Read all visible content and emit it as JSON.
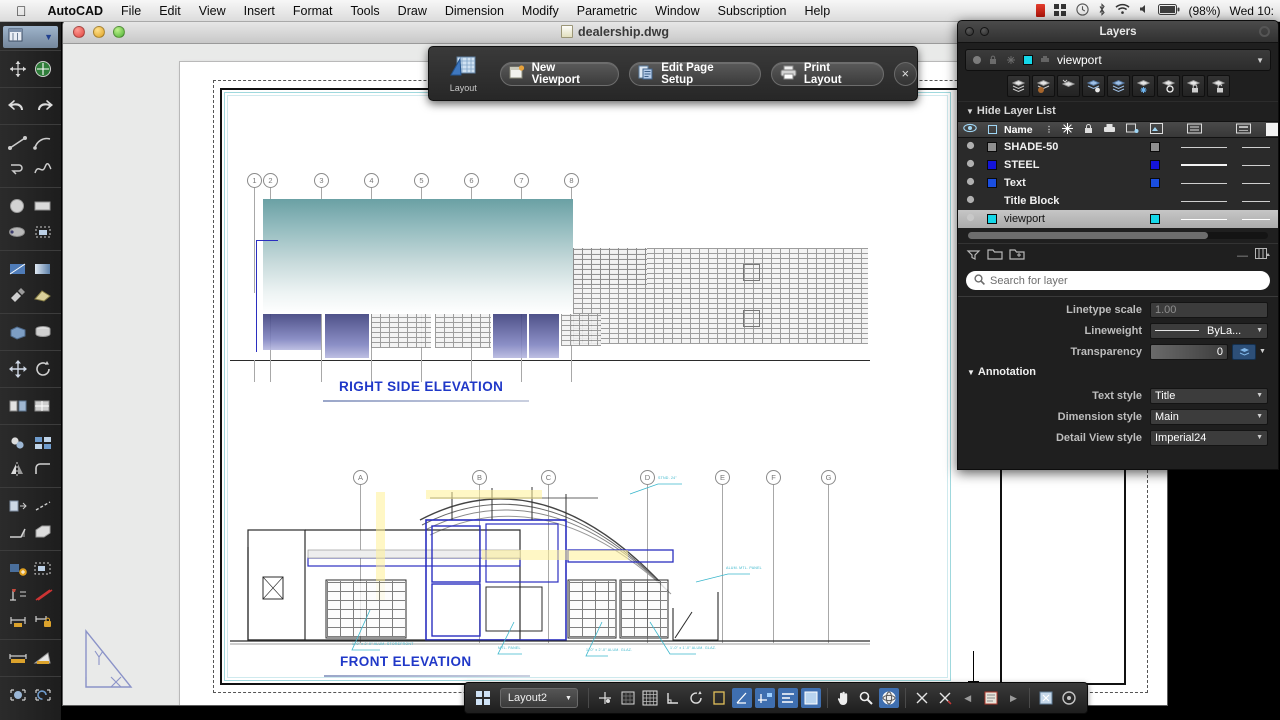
{
  "menubar": {
    "apple_icon": "apple-logo",
    "items": [
      "AutoCAD",
      "File",
      "Edit",
      "View",
      "Insert",
      "Format",
      "Tools",
      "Draw",
      "Dimension",
      "Modify",
      "Parametric",
      "Window",
      "Subscription",
      "Help"
    ],
    "status_icons": [
      "recording-icon",
      "grid-icon",
      "time-machine-icon",
      "bluetooth-icon",
      "wifi-icon",
      "volume-icon",
      "battery-icon"
    ],
    "battery": "(98%)",
    "clock": "Wed 10:"
  },
  "window": {
    "title": "dealership.dwg",
    "doc_icon": "dwg-file-icon",
    "traffic": [
      "close-button",
      "minimize-button",
      "zoom-button"
    ]
  },
  "layout_toolbar": {
    "icon_label": "Layout",
    "icon": "layout-icon",
    "buttons": [
      {
        "label": "New Viewport",
        "icon": "new-viewport-icon"
      },
      {
        "label": "Edit Page Setup",
        "icon": "page-setup-icon"
      },
      {
        "label": "Print Layout",
        "icon": "printer-icon"
      }
    ],
    "close": "×"
  },
  "drawing": {
    "right_elevation_title": "RIGHT SIDE ELEVATION",
    "front_elevation_title": "FRONT ELEVATION",
    "right_grid_bubbles": [
      "1",
      "2",
      "3",
      "4",
      "5",
      "6",
      "7",
      "8"
    ],
    "front_grid_bubbles": [
      "A",
      "B",
      "C",
      "D",
      "E",
      "F",
      "G"
    ],
    "annotations": [
      "1'-0\" x 2'-0\" ALUM. STOREFRONT",
      "MTL. PANEL",
      "1'-0\" x 2'-0\" ALUM. GLAZ.",
      "1'-0\" x 1'-0\" ALUM. GLAZ.",
      "STND. 24\"",
      "ALUM. MTL. PANEL"
    ]
  },
  "statusbar": {
    "layout_tab": "Layout2",
    "grid_icon": "grid-menu-icon",
    "tools": [
      "snap-icon",
      "grid-display-icon",
      "grid-snap-icon",
      "ortho-icon",
      "polar-icon",
      "object-snap-icon",
      "osnap-track-icon",
      "dynamic-ucs-icon",
      "dynamic-input-icon",
      "lineweight-icon",
      "transparency-icon",
      "pan-icon",
      "zoom-icon",
      "orbit-icon",
      "annotation-visibility-icon",
      "annotation-autoscale-icon",
      "prev-icon",
      "annotation-scale-icon",
      "next-icon",
      "workspace-icon",
      "hardware-accel-icon"
    ]
  },
  "left_toolbar": {
    "header_icon": "tool-sets-icon",
    "header_caret": "chevron-down-icon",
    "groups": [
      [
        "move-ucs-icon",
        "ucs-world-icon"
      ],
      [
        "undo-icon",
        "redo-icon"
      ],
      [
        "line-icon",
        "arc-icon",
        "polyline-icon",
        "spline-icon"
      ],
      [
        "circle-icon",
        "rectangle-icon",
        "ellipse-icon",
        "region-icon"
      ],
      [
        "hatch-icon",
        "gradient-icon",
        "wipeout-icon",
        "boundary-icon"
      ],
      [
        "box-solid-icon",
        "cylinder-icon"
      ],
      [
        "move-icon",
        "rotate-icon"
      ],
      [
        "array-icon",
        "trim-icon"
      ],
      [
        "copy-icon",
        "scale-icon",
        "mirror-icon",
        "fillet-icon"
      ],
      [
        "stretch-icon",
        "lengthen-icon",
        "chamfer-icon",
        "extrude-icon"
      ],
      [
        "block-insert-icon",
        "block-edit-icon",
        "attribute-icon",
        "xref-icon",
        "dim-linear-icon",
        "dim-locked-icon"
      ],
      [
        "dim-aligned-icon",
        "dim-angular-icon"
      ],
      [
        "layer-state-icon",
        "layer-prev-icon"
      ]
    ]
  },
  "layers_palette": {
    "title": "Layers",
    "window_buttons": [
      "close-dot",
      "minimize-dot"
    ],
    "settings_icon": "gear-icon",
    "current_layer": {
      "name": "viewport",
      "color": "#14d7e8",
      "on_icon": "lightbulb-icon",
      "lock_icon": "lock-icon",
      "freeze_icon": "snowflake-icon",
      "plot_icon": "plot-icon",
      "caret": "chevron-down-icon"
    },
    "toolbar_icons": [
      "new-layer-icon",
      "new-layer-frozen-icon",
      "delete-layer-icon",
      "set-current-icon",
      "layer-states-icon",
      "freeze-icon",
      "off-icon",
      "lock-icon",
      "unlock-icon"
    ],
    "hide_layer_list": "Hide Layer List",
    "hide_caret": "triangle-down-icon",
    "columns": {
      "eye": "visibility-icon",
      "status": "status-icon",
      "name": "Name",
      "sort": "sort-icon",
      "freeze": "freeze-icon",
      "lock": "lock-icon",
      "plot": "plot-icon",
      "vp_freeze": "viewport-freeze-icon",
      "color": "color-icon",
      "linetype": "linetype-icon",
      "lineweight": "lineweight-icon"
    },
    "rows": [
      {
        "name": "SHADE-50",
        "color": "#8f8f8f",
        "selected": false
      },
      {
        "name": "STEEL",
        "color": "#1414d8",
        "selected": false
      },
      {
        "name": "Text",
        "color": "#1a4ee0",
        "selected": false
      },
      {
        "name": "Title Block",
        "color": "",
        "selected": false
      },
      {
        "name": "viewport",
        "color": "#14d7e8",
        "selected": true
      }
    ],
    "bottom_icons": [
      "layer-filter-icon",
      "new-group-filter-icon",
      "new-property-filter-icon"
    ],
    "bottom_right_icons": [
      "collapse-icon",
      "view-options-icon"
    ],
    "search_placeholder": "Search for layer",
    "search_icon": "search-icon",
    "properties": [
      {
        "label": "Linetype scale",
        "value": "1.00",
        "type": "text"
      },
      {
        "label": "Lineweight",
        "value": "ByLa...",
        "type": "select",
        "swatch": "lineweight-line"
      },
      {
        "label": "Transparency",
        "value": "0",
        "type": "spin",
        "button_icon": "transparency-icon"
      }
    ],
    "annotation_section": "Annotation",
    "annotation_caret": "triangle-down-icon",
    "annotation_properties": [
      {
        "label": "Text style",
        "value": "Title"
      },
      {
        "label": "Dimension style",
        "value": "Main"
      },
      {
        "label": "Detail View style",
        "value": "Imperial24"
      }
    ]
  }
}
